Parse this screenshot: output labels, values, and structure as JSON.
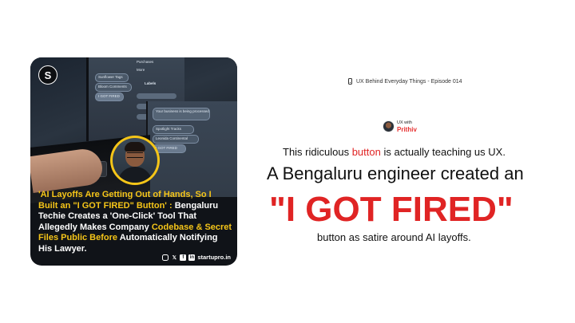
{
  "card": {
    "brand_mark": "S",
    "screen_ui": {
      "purchases": "Purchases",
      "more": "More",
      "labels": "Labels",
      "item1": "Sunflower Tags",
      "item2": "Bloom Comments",
      "item3": "I GOT FIRED",
      "item4": "Spotlight Tracks",
      "item5": "Leonida Continental",
      "item6": "I GOT FIRED",
      "alert": "Your business is being processed"
    },
    "headline_parts": [
      {
        "text": "'AI Layoffs Are Getting Out of Hands, So I Built an \"I GOT FIRED\" Button' : ",
        "highlight": true
      },
      {
        "text": "Bengaluru Techie Creates a 'One-Click' Tool ",
        "highlight": false
      },
      {
        "text": "That Allegedly Makes Company ",
        "highlight": false
      },
      {
        "text": "Codebase & Secret Files Public Before ",
        "highlight": true
      },
      {
        "text": "Automatically Notifying His Lawyer.",
        "highlight": false
      }
    ],
    "footer_site": "startupro.in",
    "social_icons": [
      "instagram-icon",
      "x-icon",
      "facebook-icon",
      "linkedin-icon"
    ]
  },
  "episode": {
    "label": "UX Behind Everyday Things - Episode 014",
    "icon": "phone-icon"
  },
  "badge": {
    "small": "UX with",
    "name": "Prithiv"
  },
  "content": {
    "line1_before": "This ridiculous ",
    "line1_highlight": "button",
    "line1_after": " is actually teaching us UX.",
    "line2": "A Bengaluru engineer created an",
    "line3": "\"I GOT FIRED\"",
    "line4": "button as satire around AI layoffs."
  },
  "colors": {
    "accent_red": "#e02424",
    "highlight_yellow": "#f5c518",
    "card_bg": "#101318"
  }
}
